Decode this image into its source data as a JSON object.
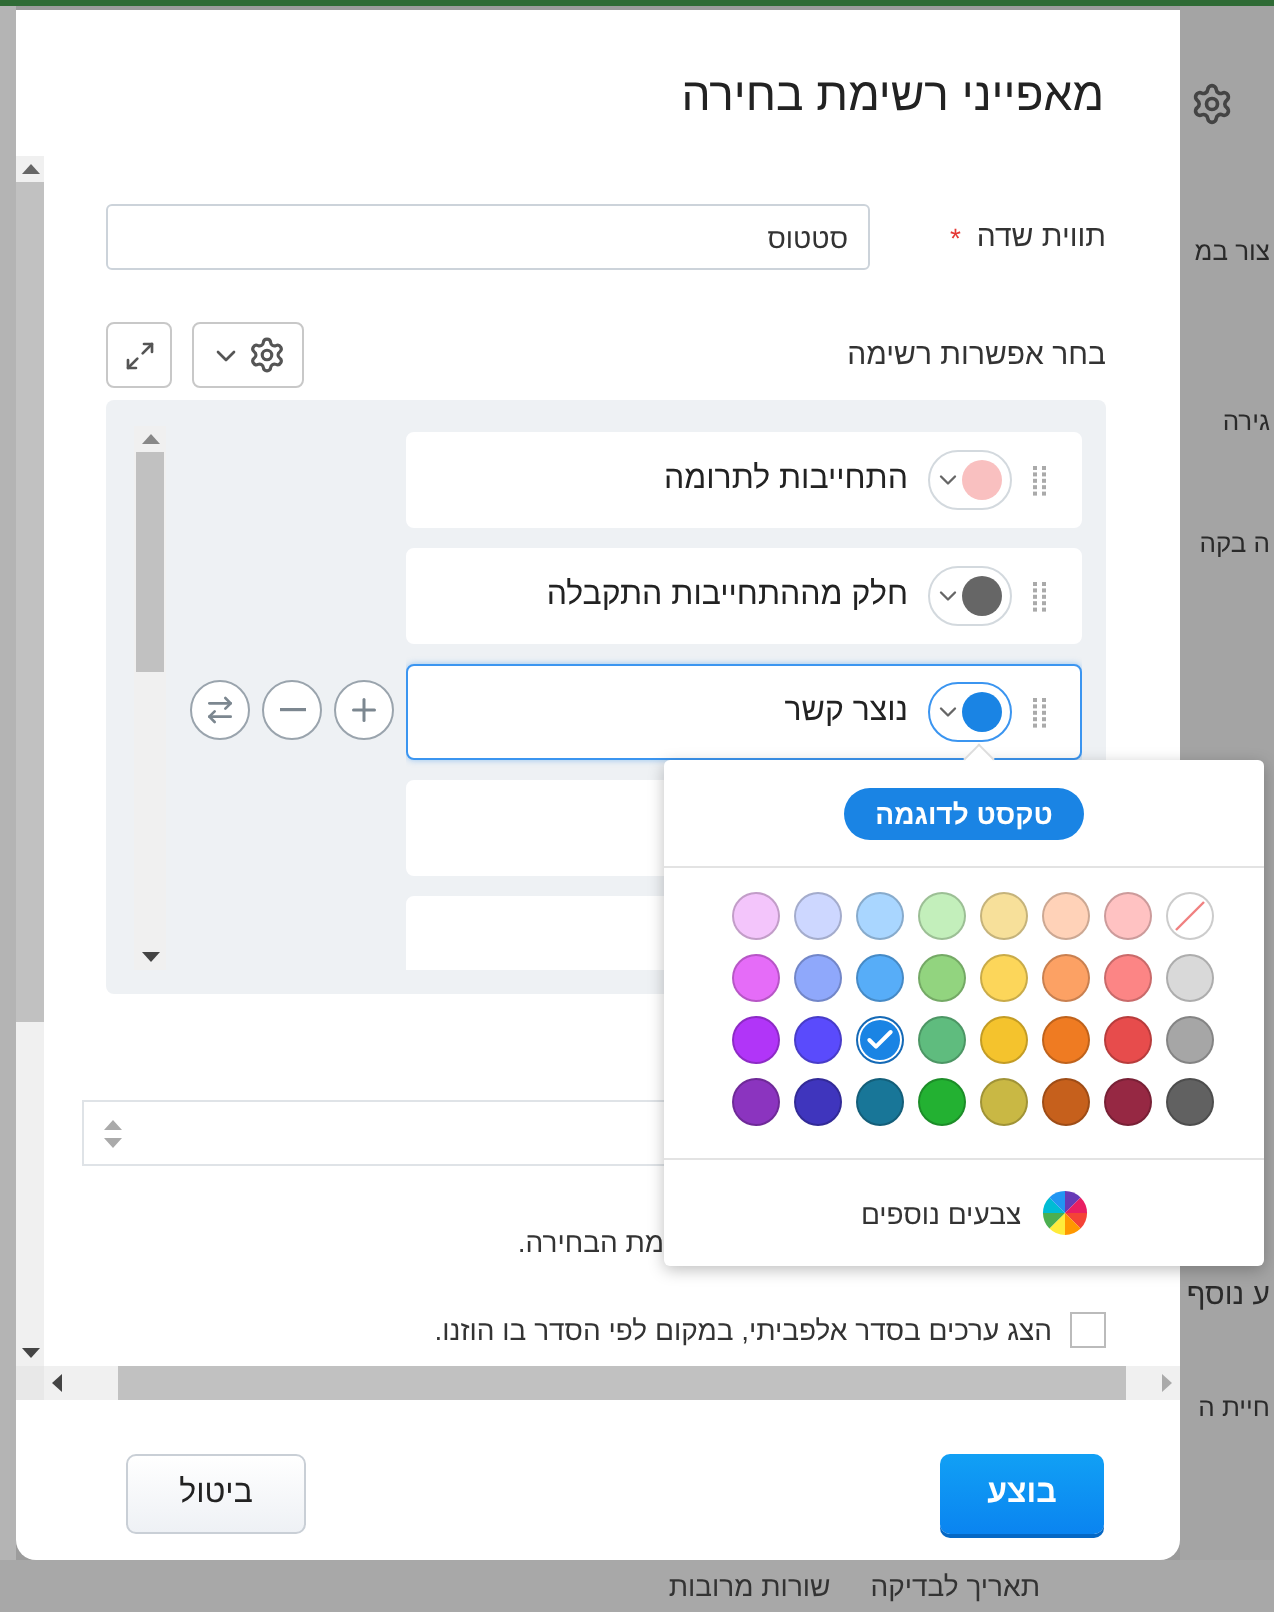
{
  "dialog": {
    "title": "מאפייני רשימת בחירה"
  },
  "field_label": {
    "label": "תווית שדה",
    "required_mark": "*",
    "value": "סטטוס"
  },
  "options_section": {
    "label": "בחר אפשרות רשימה"
  },
  "options": [
    {
      "kind": "filled",
      "label": "התחייבות לתרומה",
      "color": "#f9c0c0",
      "selected": false
    },
    {
      "kind": "filled",
      "label": "חלק מההתחייבות התקבלה",
      "color": "#666666",
      "selected": false
    },
    {
      "kind": "filled",
      "label": "נוצר קשר",
      "color": "#1a84e4",
      "selected": true
    },
    {
      "kind": "blank"
    },
    {
      "kind": "blank"
    }
  ],
  "color_picker": {
    "preview": "טקסט לדוגמה",
    "more_colors": "צבעים נוספים",
    "swatches": [
      {
        "kind": "none",
        "selected": false
      },
      {
        "kind": "color",
        "color": "#ffc2c2",
        "selected": false
      },
      {
        "kind": "color",
        "color": "#ffd2b8",
        "selected": false
      },
      {
        "kind": "color",
        "color": "#f7e09a",
        "selected": false
      },
      {
        "kind": "color",
        "color": "#c3efbb",
        "selected": false
      },
      {
        "kind": "color",
        "color": "#a9d6ff",
        "selected": false
      },
      {
        "kind": "color",
        "color": "#cdd7ff",
        "selected": false
      },
      {
        "kind": "color",
        "color": "#f3c5fb",
        "selected": false
      },
      {
        "kind": "color",
        "color": "#d9d9d9",
        "selected": false
      },
      {
        "kind": "color",
        "color": "#fc8585",
        "selected": false
      },
      {
        "kind": "color",
        "color": "#fca164",
        "selected": false
      },
      {
        "kind": "color",
        "color": "#fcd65a",
        "selected": false
      },
      {
        "kind": "color",
        "color": "#92d47f",
        "selected": false
      },
      {
        "kind": "color",
        "color": "#57adf8",
        "selected": false
      },
      {
        "kind": "color",
        "color": "#8fa8fb",
        "selected": false
      },
      {
        "kind": "color",
        "color": "#e56cf8",
        "selected": false
      },
      {
        "kind": "color",
        "color": "#a6a6a6",
        "selected": false
      },
      {
        "kind": "color",
        "color": "#e74c4c",
        "selected": false
      },
      {
        "kind": "color",
        "color": "#ef7b22",
        "selected": false
      },
      {
        "kind": "color",
        "color": "#f4c32d",
        "selected": false
      },
      {
        "kind": "color",
        "color": "#5fbc7e",
        "selected": false
      },
      {
        "kind": "color",
        "color": "#1a84e4",
        "selected": true
      },
      {
        "kind": "color",
        "color": "#5a4bfc",
        "selected": false
      },
      {
        "kind": "color",
        "color": "#b135f8",
        "selected": false
      },
      {
        "kind": "color",
        "color": "#616161",
        "selected": false
      },
      {
        "kind": "color",
        "color": "#962843",
        "selected": false
      },
      {
        "kind": "color",
        "color": "#c6601c",
        "selected": false
      },
      {
        "kind": "color",
        "color": "#c9b844",
        "selected": false
      },
      {
        "kind": "color",
        "color": "#23b132",
        "selected": false
      },
      {
        "kind": "color",
        "color": "#187698",
        "selected": false
      },
      {
        "kind": "color",
        "color": "#3f35bd",
        "selected": false
      },
      {
        "kind": "color",
        "color": "#8b34bf",
        "selected": false
      }
    ]
  },
  "hint_text": "מת הבחירה.",
  "alphabetical": {
    "label": "הצג ערכים בסדר אלפביתי, במקום לפי הסדר בו הוזנו.",
    "checked": false
  },
  "buttons": {
    "confirm": "בוצע",
    "cancel": "ביטול"
  },
  "background": {
    "right_texts": [
      "צור במ",
      "גירה",
      "ה בקה",
      "ע נוסף",
      "חיית ה"
    ],
    "bottom_texts": [
      "תאריך לבדיקה",
      "שורות מרובות"
    ]
  }
}
